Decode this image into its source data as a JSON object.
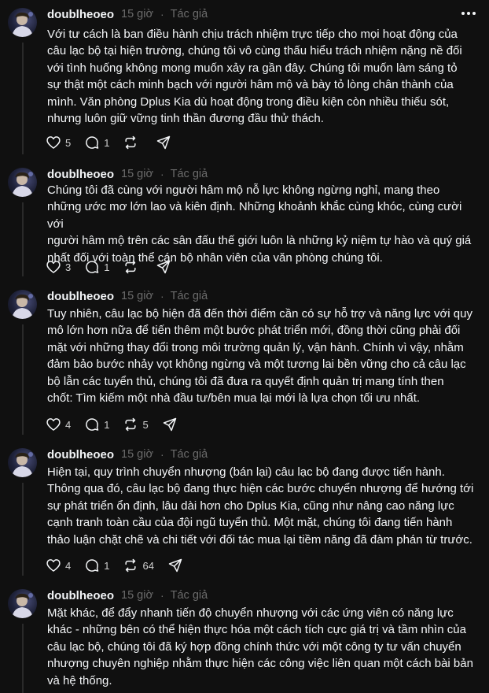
{
  "posts": [
    {
      "username": "doublheoeo",
      "time": "15 giờ",
      "separator": "·",
      "badge": "Tác giả",
      "text": "Với tư cách là ban điều hành chịu trách nhiệm trực tiếp cho mọi hoạt động của\ncâu lạc bộ tại hiện trường, chúng tôi vô cùng thấu hiểu trách nhiệm nặng nề đối\nvới tình huống không mong muốn xảy ra gần đây. Chúng tôi muốn làm sáng tỏ\nsự thật một cách minh bạch với người hâm mộ và bày tỏ lòng chân thành của\nmình. Văn phòng Dplus Kia dù hoạt động trong điều kiện còn nhiều thiếu sót,\nnhưng luôn giữ vững tinh thần đương đầu thử thách.",
      "likes": "5",
      "replies": "1",
      "reposts": ""
    },
    {
      "username": "doublheoeo",
      "time": "15 giờ",
      "separator": "·",
      "badge": "Tác giả",
      "text": "Chúng tôi đã cùng với người hâm mộ nỗ lực không ngừng nghỉ, mang theo\nnhững ước mơ lớn lao và kiên định. Những khoảnh khắc cùng khóc, cùng cười với\nngười hâm mộ trên các sân đấu thế giới luôn là những kỷ niệm tự hào và quý giá\nnhất đối với toàn thể cán bộ nhân viên của văn phòng chúng tôi.",
      "likes": "3",
      "replies": "1",
      "reposts": ""
    },
    {
      "username": "doublheoeo",
      "time": "15 giờ",
      "separator": "·",
      "badge": "Tác giả",
      "text": "Tuy nhiên, câu lạc bộ hiện đã đến thời điểm cần có sự hỗ trợ và năng lực với quy\nmô lớn hơn nữa để tiến thêm một bước phát triển mới, đồng thời cũng phải đối\nmặt với những thay đổi trong môi trường quản lý, vận hành. Chính vì vậy, nhằm\nđảm bảo bước nhảy vọt không ngừng và một tương lai bền vững cho cả câu lạc\nbộ lẫn các tuyển thủ, chúng tôi đã đưa ra quyết định quản trị mang tính then\nchốt: Tìm kiếm một nhà đầu tư/bên mua lại mới là lựa chọn tối ưu nhất.",
      "likes": "4",
      "replies": "1",
      "reposts": "5"
    },
    {
      "username": "doublheoeo",
      "time": "15 giờ",
      "separator": "·",
      "badge": "Tác giả",
      "text": "Hiện tại, quy trình chuyển nhượng (bán lại) câu lạc bộ đang được tiến hành.\nThông qua đó, câu lạc bộ đang thực hiện các bước chuyển nhượng để hướng tới\nsự phát triển ổn định, lâu dài hơn cho Dplus Kia, cũng như nâng cao năng lực\ncạnh tranh toàn cầu của đội ngũ tuyển thủ. Một mặt, chúng tôi đang tiến hành\nthảo luận chặt chẽ và chi tiết với đối tác mua lại tiềm năng đã đàm phán từ trước.",
      "likes": "4",
      "replies": "1",
      "reposts": "64"
    },
    {
      "username": "doublheoeo",
      "time": "15 giờ",
      "separator": "·",
      "badge": "Tác giả",
      "text": "Mặt khác, để đẩy nhanh tiến độ chuyển nhượng với các ứng viên có năng lực\nkhác - những bên có thể hiện thực hóa một cách tích cực giá trị và tầm nhìn của\ncâu lạc bộ, chúng tôi đã ký hợp đồng chính thức với một công ty tư vấn chuyển\nnhượng chuyên nghiệp nhằm thực hiện các công việc liên quan một cách bài bản\nvà hệ thống."
    }
  ],
  "icons": {
    "more": "more-icon",
    "like": "heart-icon",
    "reply": "comment-icon",
    "repost": "repost-icon",
    "share": "share-icon"
  }
}
